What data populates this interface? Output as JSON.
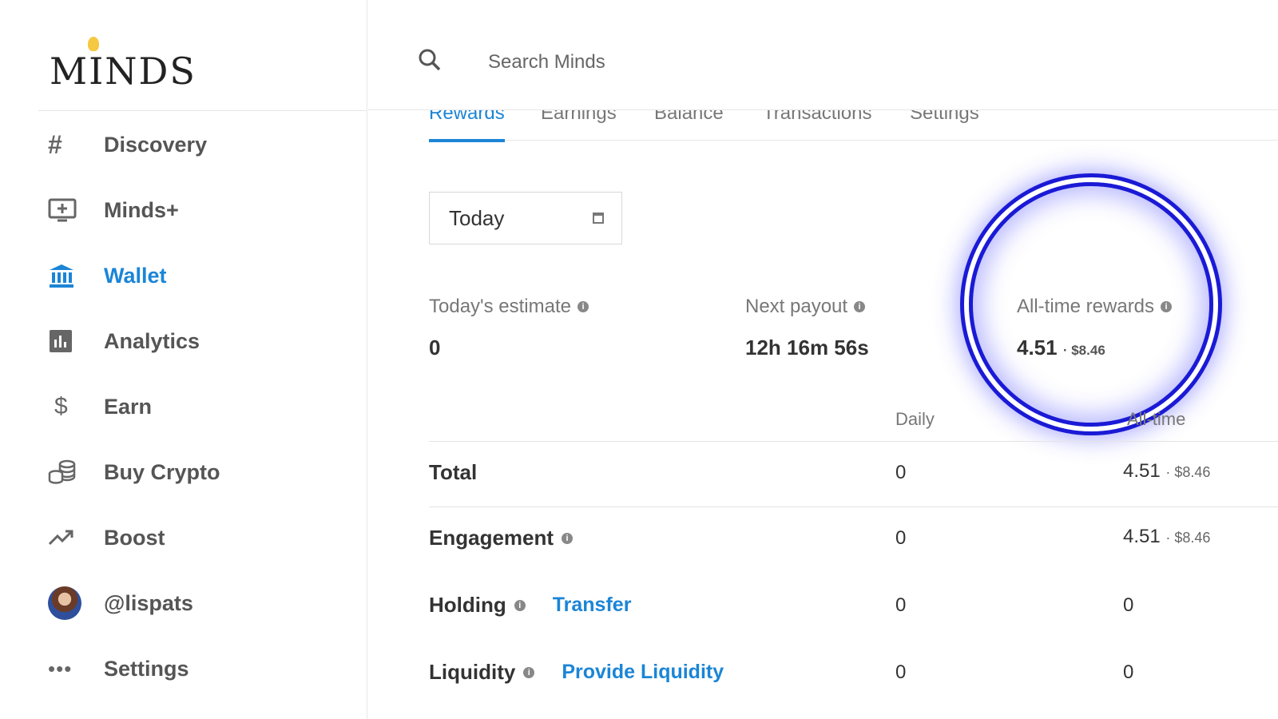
{
  "app": {
    "logo_text": "MINDS"
  },
  "sidebar": {
    "items": [
      {
        "label": "Discovery",
        "icon": "hash-icon"
      },
      {
        "label": "Minds+",
        "icon": "monitor-plus-icon"
      },
      {
        "label": "Wallet",
        "icon": "bank-icon",
        "active": true
      },
      {
        "label": "Analytics",
        "icon": "bar-chart-icon"
      },
      {
        "label": "Earn",
        "icon": "dollar-icon"
      },
      {
        "label": "Buy Crypto",
        "icon": "coins-icon"
      },
      {
        "label": "Boost",
        "icon": "trending-up-icon"
      },
      {
        "label": "@lispats",
        "icon": "avatar"
      },
      {
        "label": "Settings",
        "icon": "more-icon"
      }
    ]
  },
  "search": {
    "placeholder": "Search Minds"
  },
  "tabs": [
    {
      "label": "Rewards",
      "active": true
    },
    {
      "label": "Earnings"
    },
    {
      "label": "Balance"
    },
    {
      "label": "Transactions"
    },
    {
      "label": "Settings"
    }
  ],
  "date_select": {
    "value": "Today"
  },
  "stats": {
    "estimate": {
      "title": "Today's estimate",
      "value": "0"
    },
    "payout": {
      "title": "Next payout",
      "value": "12h 16m 56s"
    },
    "alltime": {
      "title": "All-time rewards",
      "value": "4.51",
      "usd": "· $8.46"
    }
  },
  "table": {
    "col_daily": "Daily",
    "col_alltime": "All-time",
    "rows": [
      {
        "label": "Total",
        "daily": "0",
        "alltime": "4.51",
        "alltime_usd": "· $8.46"
      },
      {
        "label": "Engagement",
        "daily": "0",
        "alltime": "4.51",
        "alltime_usd": "· $8.46"
      },
      {
        "label": "Holding",
        "link": "Transfer",
        "daily": "0",
        "alltime": "0"
      },
      {
        "label": "Liquidity",
        "link": "Provide Liquidity",
        "daily": "0",
        "alltime": "0"
      }
    ]
  },
  "colors": {
    "accent": "#1b85d6",
    "highlight": "#1a1ad6"
  }
}
